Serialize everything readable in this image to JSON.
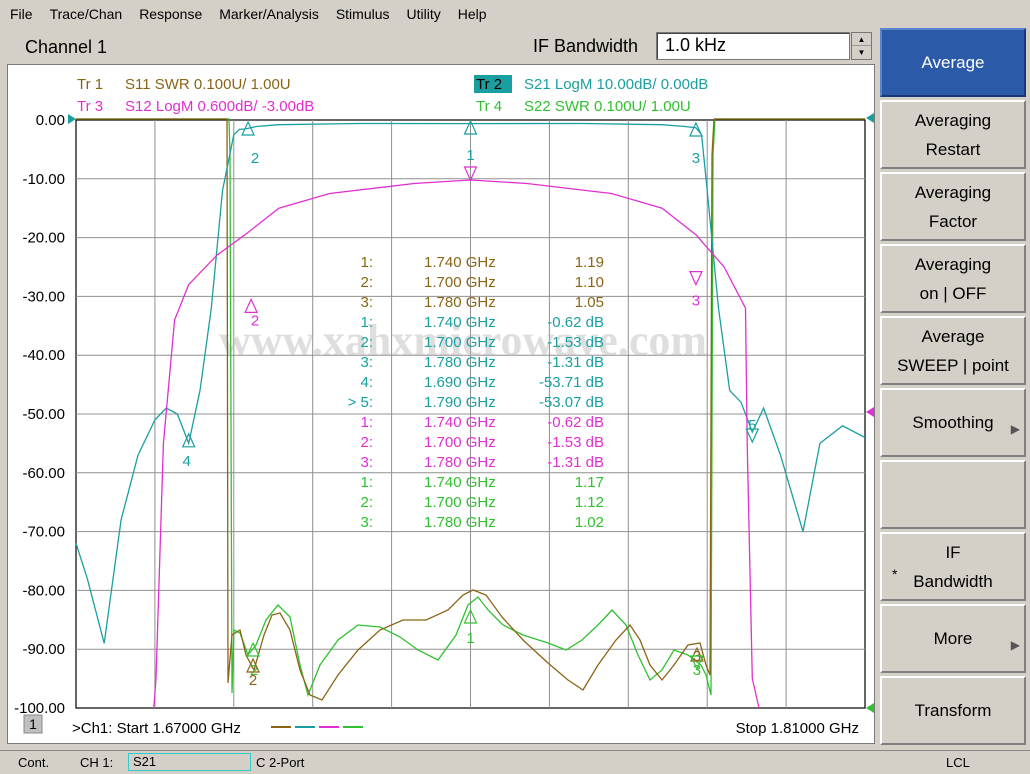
{
  "menu": [
    "File",
    "Trace/Chan",
    "Response",
    "Marker/Analysis",
    "Stimulus",
    "Utility",
    "Help"
  ],
  "header": {
    "channel": "Channel 1",
    "ifbw_label": "IF Bandwidth",
    "ifbw_value": "1.0 kHz"
  },
  "colors": {
    "tr1": "#8a6414",
    "tr2": "#1a9fa0",
    "tr3": "#e030d0",
    "tr4": "#30c030",
    "grid": "#909090"
  },
  "traces": {
    "tr1": {
      "id": "Tr 1",
      "label": "S11 SWR 0.100U/  1.00U"
    },
    "tr2": {
      "id": "Tr 2",
      "label": "S21 LogM 10.00dB/  0.00dB"
    },
    "tr3": {
      "id": "Tr 3",
      "label": "S12 LogM 0.600dB/  -3.00dB"
    },
    "tr4": {
      "id": "Tr 4",
      "label": "S22 SWR 0.100U/  1.00U"
    }
  },
  "watermark": "www.xahxmicrowave.com",
  "markers": [
    {
      "trace": "tr1",
      "rows": [
        [
          "1:",
          "1.740 GHz",
          "1.19"
        ],
        [
          "2:",
          "1.700 GHz",
          "1.10"
        ],
        [
          "3:",
          "1.780 GHz",
          "1.05"
        ]
      ]
    },
    {
      "trace": "tr2",
      "rows": [
        [
          "1:",
          "1.740 GHz",
          "-0.62 dB"
        ],
        [
          "2:",
          "1.700 GHz",
          "-1.53 dB"
        ],
        [
          "3:",
          "1.780 GHz",
          "-1.31 dB"
        ],
        [
          "4:",
          "1.690 GHz",
          "-53.71 dB"
        ],
        [
          "> 5:",
          "1.790 GHz",
          "-53.07 dB"
        ]
      ]
    },
    {
      "trace": "tr3",
      "rows": [
        [
          "1:",
          "1.740 GHz",
          "-0.62 dB"
        ],
        [
          "2:",
          "1.700 GHz",
          "-1.53 dB"
        ],
        [
          "3:",
          "1.780 GHz",
          "-1.31 dB"
        ]
      ]
    },
    {
      "trace": "tr4",
      "rows": [
        [
          "1:",
          "1.740 GHz",
          "1.17"
        ],
        [
          "2:",
          "1.700 GHz",
          "1.12"
        ],
        [
          "3:",
          "1.780 GHz",
          "1.02"
        ]
      ]
    }
  ],
  "footer": {
    "channel_no": "1",
    "start": ">Ch1: Start  1.67000 GHz",
    "stop": "Stop  1.81000 GHz"
  },
  "softkeys": [
    {
      "name": "average",
      "lines": [
        "Average"
      ]
    },
    {
      "name": "averaging-restart",
      "lines": [
        "Averaging",
        "Restart"
      ]
    },
    {
      "name": "averaging-factor",
      "lines": [
        "Averaging",
        "Factor"
      ]
    },
    {
      "name": "averaging-on-off",
      "lines": [
        "Averaging",
        "on | OFF"
      ]
    },
    {
      "name": "average-sweep-point",
      "lines": [
        "Average",
        "SWEEP | point"
      ]
    },
    {
      "name": "smoothing",
      "lines": [
        "Smoothing"
      ],
      "arrow": true
    },
    {
      "name": "blank",
      "lines": [
        ""
      ]
    },
    {
      "name": "if-bandwidth",
      "lines": [
        "IF",
        "Bandwidth"
      ],
      "star": true
    },
    {
      "name": "more",
      "lines": [
        "More"
      ],
      "arrow": true
    },
    {
      "name": "transform",
      "lines": [
        "Transform"
      ]
    }
  ],
  "status": {
    "mode": "Cont.",
    "ch": "CH 1:",
    "param": "S21",
    "cal": "C  2-Port",
    "ref": "LCL"
  },
  "chart_data": {
    "type": "line",
    "xlabel": "",
    "xlim": [
      1.67,
      1.81
    ],
    "ylim": [
      -100,
      0
    ],
    "yticks": [
      "0.00",
      "-10.00",
      "-20.00",
      "-30.00",
      "-40.00",
      "-50.00",
      "-60.00",
      "-70.00",
      "-80.00",
      "-90.00",
      "-100.00"
    ],
    "grid": true,
    "series": [
      {
        "name": "S21",
        "trace": "tr2",
        "x": [
          1.67,
          1.672,
          1.675,
          1.678,
          1.681,
          1.684,
          1.686,
          1.688,
          1.69,
          1.692,
          1.694,
          1.696,
          1.698,
          1.699,
          1.7,
          1.702,
          1.706,
          1.72,
          1.74,
          1.76,
          1.774,
          1.778,
          1.78,
          1.781,
          1.782,
          1.784,
          1.786,
          1.788,
          1.79,
          1.792,
          1.795,
          1.799,
          1.802,
          1.806,
          1.81
        ],
        "y": [
          -72,
          -78,
          -89,
          -68,
          -57,
          -51,
          -49,
          -50,
          -55,
          -46,
          -32,
          -12,
          -2.5,
          -1.6,
          -1.53,
          -1.1,
          -0.8,
          -0.6,
          -0.62,
          -0.6,
          -0.8,
          -1.1,
          -1.31,
          -2.5,
          -12,
          -32,
          -46,
          -48,
          -53.07,
          -49,
          -57,
          -70,
          -55,
          -52,
          -54
        ]
      },
      {
        "name": "S12",
        "trace": "tr3",
        "x": [
          1.6838,
          1.6842,
          1.6855,
          1.6875,
          1.69,
          1.695,
          1.7,
          1.706,
          1.715,
          1.73,
          1.74,
          1.75,
          1.765,
          1.774,
          1.78,
          1.785,
          1.7888,
          1.7891,
          1.79,
          1.7912
        ],
        "y": [
          -100,
          -95,
          -55,
          -34,
          -28,
          -23,
          -19.5,
          -15,
          -12.5,
          -10.8,
          -10.2,
          -10.8,
          -12.5,
          -15,
          -19.5,
          -25,
          -32,
          -55,
          -95,
          -100
        ]
      }
    ]
  }
}
